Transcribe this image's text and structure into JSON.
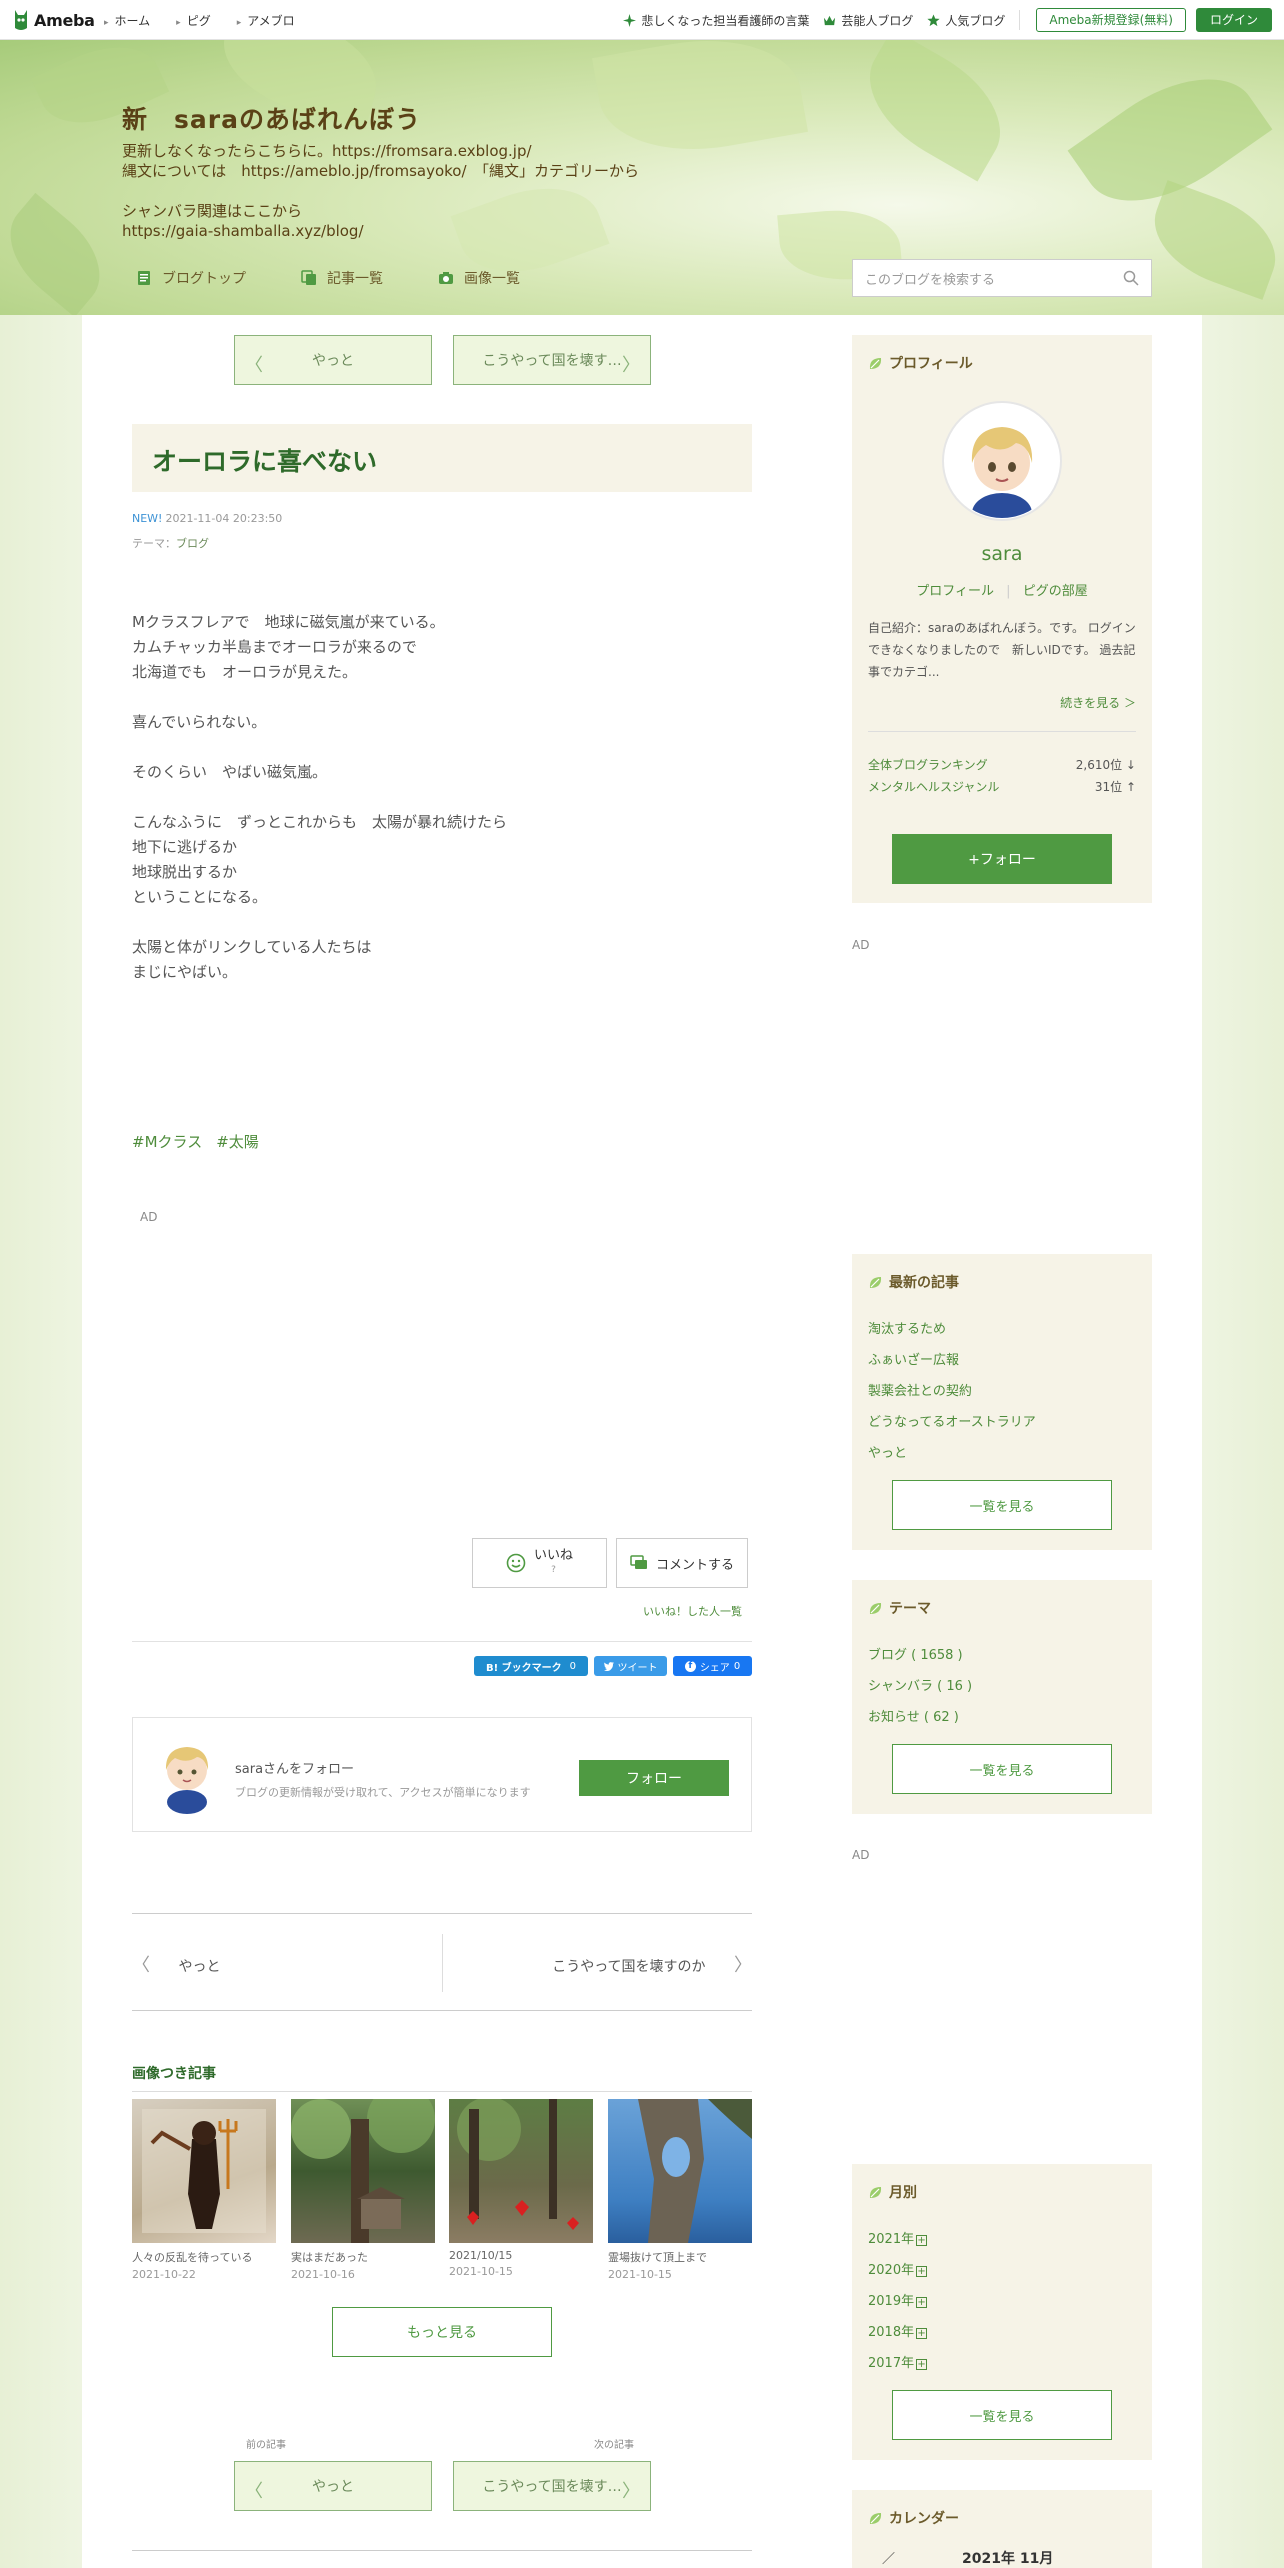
{
  "gnav": {
    "logo": "Ameba",
    "links": [
      "ホーム",
      "ピグ",
      "アメブロ"
    ],
    "picks": [
      "悲しくなった担当看護師の言葉",
      "芸能人ブログ",
      "人気ブログ"
    ],
    "register": "Ameba新規登録(無料)",
    "login": "ログイン"
  },
  "header": {
    "title": "新　saraのあばれんぼう",
    "desc": [
      "更新しなくなったらこちらに。https://fromsara.exblog.jp/",
      "縄文については　https://ameblo.jp/fromsayoko/　「縄文」カテゴリーから",
      "",
      "シャンバラ関連はここから",
      "https://gaia-shamballa.xyz/blog/"
    ],
    "nav": [
      "ブログトップ",
      "記事一覧",
      "画像一覧"
    ],
    "search_placeholder": "このブログを検索する"
  },
  "pager_top": {
    "prev": "やっと",
    "next": "こうやって国を壊す…"
  },
  "article": {
    "title": "オーロラに喜べない",
    "new_label": "NEW!",
    "date": "2021-11-04 20:23:50",
    "theme_label": "テーマ：",
    "theme": "ブログ",
    "body": [
      "Mクラスフレアで　地球に磁気嵐が来ている。",
      "カムチャッカ半島までオーロラが来るので",
      "北海道でも　オーロラが見えた。",
      "",
      "喜んでいられない。",
      "",
      "そのくらい　やばい磁気嵐。",
      "",
      "こんなふうに　ずっとこれからも　太陽が暴れ続けたら",
      "地下に逃げるか",
      "地球脱出するか",
      "ということになる。",
      "",
      "太陽と体がリンクしている人たちは",
      "まじにやばい。"
    ],
    "hashtags": [
      "#Mクラス",
      "#太陽"
    ]
  },
  "ad_label": "AD",
  "reactions": {
    "like": "いいね",
    "like_count": "?",
    "comment": "コメントする",
    "likes_list": "いいね！した人一覧"
  },
  "share": {
    "hatena": "B! ブックマーク",
    "hatena_count": "0",
    "tweet": "ツイート",
    "fb": "シェア",
    "fb_count": "0"
  },
  "follow_card": {
    "title": "saraさんをフォロー",
    "sub": "ブログの更新情報が受け取れて、アクセスが簡単になります",
    "button": "フォロー"
  },
  "bottom_nav": {
    "prev": "やっと",
    "next": "こうやって国を壊すのか"
  },
  "image_articles": {
    "heading": "画像つき記事",
    "items": [
      {
        "caption": "人々の反乱を待っている",
        "date": "2021-10-22"
      },
      {
        "caption": "実はまだあった",
        "date": "2021-10-16"
      },
      {
        "caption": "2021/10/15",
        "date": "2021-10-15"
      },
      {
        "caption": "霊場抜けて頂上まで",
        "date": "2021-10-15"
      }
    ],
    "more": "もっと見る"
  },
  "pager_bottom": {
    "prev_label": "前の記事",
    "next_label": "次の記事",
    "prev": "やっと",
    "next": "こうやって国を壊す…"
  },
  "sidebar": {
    "profile": {
      "heading": "プロフィール",
      "name": "sara",
      "links": [
        "プロフィール",
        "ピグの部屋"
      ],
      "intro": "自己紹介：saraのあばれんぼう。です。 ログインできなくなりましたので　新しいIDです。 過去記事でカテゴ...",
      "more": "続きを見る ＞",
      "rank_label": "全体ブログランキング",
      "rank_value": "2,610位 ↓",
      "genre_label": "メンタルヘルスジャンル",
      "genre_value": "31位 ↑",
      "follow": "+フォロー"
    },
    "recent": {
      "heading": "最新の記事",
      "items": [
        "淘汰するため",
        "ふぁいざー広報",
        "製薬会社との契約",
        "どうなってるオーストラリア",
        "やっと"
      ],
      "more": "一覧を見る"
    },
    "themes": {
      "heading": "テーマ",
      "items": [
        "ブログ ( 1658 )",
        "シャンバラ ( 16 )",
        "お知らせ ( 62 )"
      ],
      "more": "一覧を見る"
    },
    "monthly": {
      "heading": "月別",
      "items": [
        "2021年",
        "2020年",
        "2019年",
        "2018年",
        "2017年"
      ],
      "more": "一覧を見る"
    },
    "calendar": {
      "heading": "カレンダー",
      "month": "2021年 11月"
    }
  },
  "colors": {
    "accent": "#4f9a42",
    "title_brown": "#5a4116",
    "article_green": "#2e6a2a"
  }
}
